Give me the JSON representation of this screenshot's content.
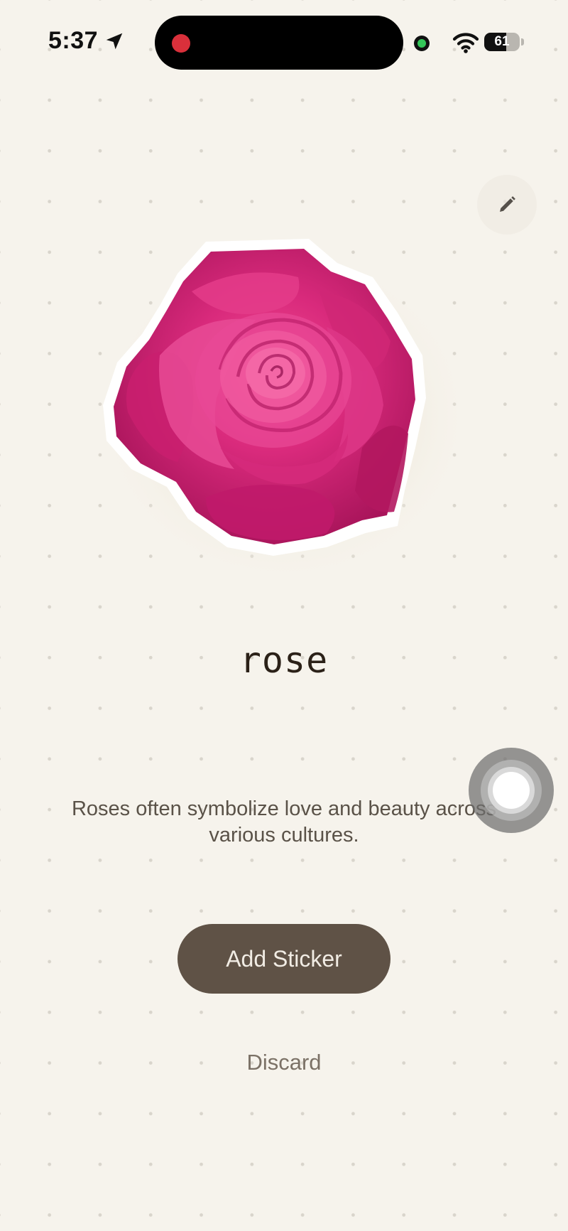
{
  "status_bar": {
    "time": "5:37",
    "battery_level": "61",
    "icons": [
      "location-arrow-icon",
      "recording-indicator",
      "camera-in-use-indicator",
      "wifi-icon",
      "battery-icon"
    ],
    "colors": {
      "record": "#d9303b",
      "camera_indicator": "#34c759"
    }
  },
  "toolbar": {
    "edit_icon": "pencil-icon"
  },
  "sticker": {
    "name": "rose",
    "description": "Roses often symbolize love and beauty across various cultures.",
    "image": "rose-flower-sticker"
  },
  "actions": {
    "add_label": "Add Sticker",
    "discard_label": "Discard"
  },
  "theme": {
    "background": "#f6f3ec",
    "primary_button": "#5f5246",
    "primary_button_text": "#f1ece4",
    "title_text": "#2b2118",
    "body_text": "#5a5248",
    "secondary_text": "#7b7166",
    "rose": "#d6297a"
  },
  "overlay": {
    "assistive_touch_icon": "assistive-touch-icon"
  }
}
